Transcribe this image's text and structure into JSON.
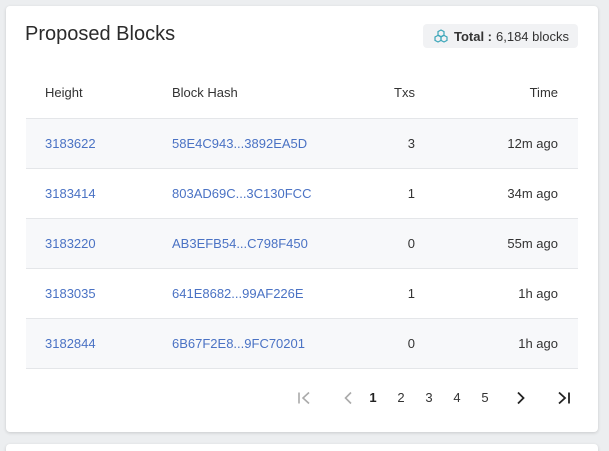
{
  "card": {
    "title": "Proposed Blocks",
    "total_label": "Total :",
    "total_value": "6,184 blocks"
  },
  "table": {
    "headers": {
      "height": "Height",
      "hash": "Block Hash",
      "txs": "Txs",
      "time": "Time"
    },
    "rows": [
      {
        "height": "3183622",
        "hash": "58E4C943...3892EA5D",
        "txs": "3",
        "time": "12m ago"
      },
      {
        "height": "3183414",
        "hash": "803AD69C...3C130FCC",
        "txs": "1",
        "time": "34m ago"
      },
      {
        "height": "3183220",
        "hash": "AB3EFB54...C798F450",
        "txs": "0",
        "time": "55m ago"
      },
      {
        "height": "3183035",
        "hash": "641E8682...99AF226E",
        "txs": "1",
        "time": "1h ago"
      },
      {
        "height": "3182844",
        "hash": "6B67F2E8...9FC70201",
        "txs": "0",
        "time": "1h ago"
      }
    ]
  },
  "pagination": {
    "pages": [
      "1",
      "2",
      "3",
      "4",
      "5"
    ],
    "current": "1",
    "icons": [
      "first-page-icon",
      "prev-page-icon",
      "next-page-icon",
      "last-page-icon"
    ]
  },
  "colors": {
    "link": "#4a72c4",
    "badge_bg": "#f1f2f4",
    "row_alt": "#f7f8fa",
    "icon_teal": "#3aa6b9"
  }
}
